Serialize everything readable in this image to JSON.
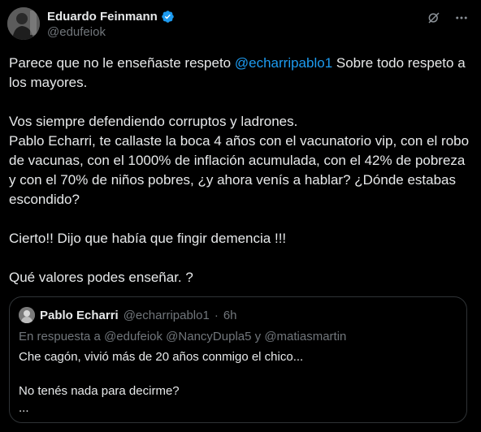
{
  "author": {
    "display_name": "Eduardo Feinmann",
    "handle": "@edufeiok",
    "verified": true
  },
  "icons": {
    "verified": "verified-badge-icon",
    "grok": "grok-icon",
    "more": "more-options-icon"
  },
  "colors": {
    "background": "#000000",
    "text": "#e7e9ea",
    "secondary": "#71767b",
    "link": "#1d9bf0",
    "border": "#2f3336"
  },
  "tweet": {
    "line1_prefix": "Parece que no le enseñaste respeto ",
    "line1_mention": "@echarripablo1",
    "line1_suffix": "  Sobre todo respeto a los mayores.",
    "para2": "Vos siempre defendiendo corruptos y ladrones.",
    "para3": "Pablo Echarri, te callaste la boca 4 años con el vacunatorio vip, con el robo de vacunas, con el 1000% de inflación acumulada, con el 42% de pobreza y con el 70% de niños pobres, ¿y ahora venís a hablar? ¿Dónde estabas escondido?",
    "para4": "Cierto!!  Dijo que había que fingir demencia !!!",
    "para5": "Qué valores podes enseñar. ?"
  },
  "quoted": {
    "display_name": "Pablo Echarri",
    "handle": "@echarripablo1",
    "separator": "·",
    "time": "6h",
    "reply_prefix": "En respuesta a ",
    "reply_mentions": "@edufeiok @NancyDupla5",
    "reply_and": " y ",
    "reply_last": "@matiasmartin",
    "line1": "Che cagón, vivió más de 20 años conmigo  el chico...",
    "line2": "No tenés nada para decirme?",
    "line3": "..."
  }
}
